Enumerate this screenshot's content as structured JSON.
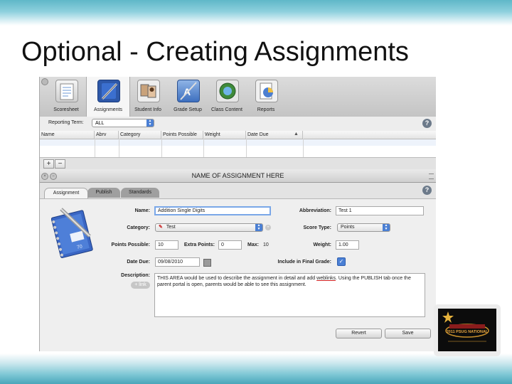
{
  "slide": {
    "title": "Optional - Creating Assignments"
  },
  "toolbar": {
    "items": [
      {
        "label": "Scoresheet",
        "icon": "scoresheet-icon"
      },
      {
        "label": "Assignments",
        "icon": "assignments-icon",
        "active": true
      },
      {
        "label": "Student Info",
        "icon": "student-info-icon"
      },
      {
        "label": "Grade Setup",
        "icon": "grade-setup-icon"
      },
      {
        "label": "Class Content",
        "icon": "class-content-icon"
      },
      {
        "label": "Reports",
        "icon": "reports-icon"
      }
    ]
  },
  "reporting": {
    "label": "Reporting Term:",
    "value": "ALL"
  },
  "grid": {
    "columns": [
      "Name",
      "Abrv",
      "Category",
      "Points Possible",
      "Weight",
      "Date Due"
    ]
  },
  "dialog": {
    "title": "NAME OF ASSIGNMENT HERE",
    "tabs": [
      "Assignment",
      "Publish",
      "Standards"
    ],
    "labels": {
      "name": "Name:",
      "abbreviation": "Abbreviation:",
      "category": "Category:",
      "score_type": "Score Type:",
      "points_possible": "Points Possible:",
      "extra_points": "Extra Points:",
      "max": "Max:",
      "weight": "Weight:",
      "date_due": "Date Due:",
      "include": "Include in Final Grade:",
      "description": "Description:"
    },
    "values": {
      "name": "Addition Single Digits",
      "abbreviation": "Test 1",
      "category": "Test",
      "score_type": "Points",
      "points_possible": "10",
      "extra_points": "0",
      "max": "10",
      "weight": "1.00",
      "date_due": "09/08/2010",
      "include_checked": true,
      "description_before": "THIS AREA would be used to describe the assignment in detail and add ",
      "description_link": "weblinks",
      "description_after": ".  Using the PUBLISH tab once the parent portal is open, parents would be able to see this assignment."
    },
    "link_button": "+ link",
    "buttons": {
      "revert": "Revert",
      "save": "Save"
    }
  },
  "logo": {
    "text": "2011 PSUG NATIONAL"
  },
  "colors": {
    "accent": "#4a7fd4",
    "band": "#5fb7c8"
  }
}
